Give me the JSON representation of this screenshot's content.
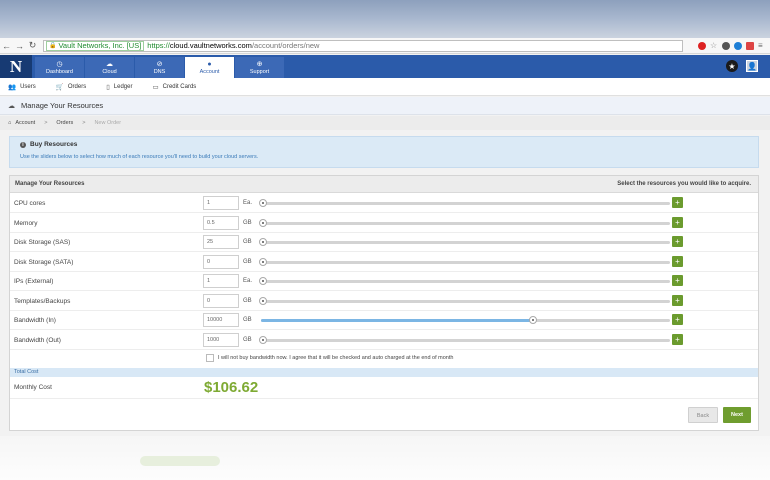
{
  "browser": {
    "ev_label": "Vault Networks, Inc. [US]",
    "url_scheme": "https://",
    "url_host": "cloud.vaultnetworks.com",
    "url_path": "/account/orders/new"
  },
  "nav": {
    "logo": "N",
    "tabs": [
      {
        "label": "Dashboard",
        "icon": "dashboard-icon"
      },
      {
        "label": "Cloud",
        "icon": "cloud-icon"
      },
      {
        "label": "DNS",
        "icon": "dns-icon"
      },
      {
        "label": "Account",
        "icon": "user-icon",
        "active": true
      },
      {
        "label": "Support",
        "icon": "support-icon"
      }
    ]
  },
  "subnav": {
    "items": [
      {
        "label": "Users",
        "icon": "users-icon"
      },
      {
        "label": "Orders",
        "icon": "cart-icon"
      },
      {
        "label": "Ledger",
        "icon": "book-icon"
      },
      {
        "label": "Credit Cards",
        "icon": "credit-card-icon"
      }
    ]
  },
  "page": {
    "title": "Manage Your Resources",
    "breadcrumbs": [
      "Account",
      "Orders",
      "New Order"
    ]
  },
  "info": {
    "title": "Buy Resources",
    "text": "Use the sliders below to select how much of each resource you'll need to build your cloud servers."
  },
  "panel": {
    "title": "Manage Your Resources",
    "subtitle": "Select the resources you would like to acquire."
  },
  "resources": [
    {
      "label": "CPU cores",
      "value": "1",
      "unit": "Ea.",
      "level": 0
    },
    {
      "label": "Memory",
      "value": "0.5",
      "unit": "GB",
      "level": 0
    },
    {
      "label": "Disk Storage (SAS)",
      "value": "25",
      "unit": "GB",
      "level": 0
    },
    {
      "label": "Disk Storage (SATA)",
      "value": "0",
      "unit": "GB",
      "level": 0
    },
    {
      "label": "IPs (External)",
      "value": "1",
      "unit": "Ea.",
      "level": 0
    },
    {
      "label": "Templates/Backups",
      "value": "0",
      "unit": "GB",
      "level": 0
    },
    {
      "label": "Bandwidth (In)",
      "value": "10000",
      "unit": "GB",
      "level": 0.66
    },
    {
      "label": "Bandwidth (Out)",
      "value": "1000",
      "unit": "GB",
      "level": 0
    }
  ],
  "bandwidth_notice": "I will not buy bandwidth now. I agree that it will be checked and auto charged at the end of month",
  "total": {
    "section_label": "Total Cost",
    "monthly_label": "Monthly Cost",
    "amount": "$106.62"
  },
  "buttons": {
    "back": "Back",
    "next": "Next"
  },
  "colors": {
    "nav": "#2b5baa",
    "accent_green": "#6f9d2f",
    "price_green": "#7eaa33",
    "slider_fill": "#7cb6e4"
  }
}
